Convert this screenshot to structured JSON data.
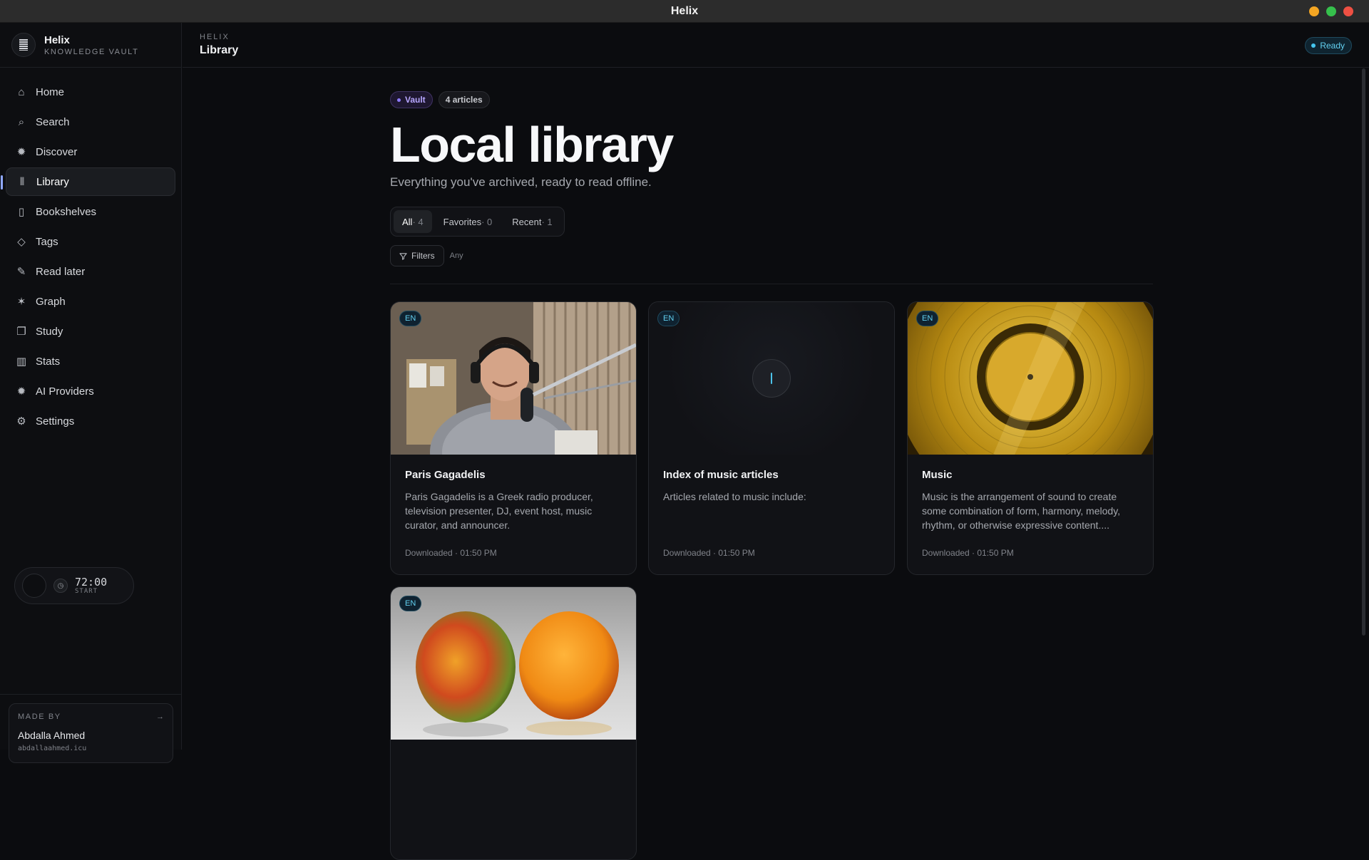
{
  "window": {
    "title": "Helix"
  },
  "brand": {
    "name": "Helix",
    "subtitle": "KNOWLEDGE VAULT"
  },
  "nav": [
    {
      "label": "Home",
      "icon": "home-icon",
      "glyph": "⌂",
      "active": false
    },
    {
      "label": "Search",
      "icon": "search-icon",
      "glyph": "⌕",
      "active": false
    },
    {
      "label": "Discover",
      "icon": "compass-icon",
      "glyph": "✹",
      "active": false
    },
    {
      "label": "Library",
      "icon": "library-icon",
      "glyph": "⫴",
      "active": true
    },
    {
      "label": "Bookshelves",
      "icon": "bookmark-icon",
      "glyph": "▯",
      "active": false
    },
    {
      "label": "Tags",
      "icon": "tag-icon",
      "glyph": "◇",
      "active": false
    },
    {
      "label": "Read later",
      "icon": "pin-icon",
      "glyph": "✎",
      "active": false
    },
    {
      "label": "Graph",
      "icon": "graph-icon",
      "glyph": "✶",
      "active": false
    },
    {
      "label": "Study",
      "icon": "cards-icon",
      "glyph": "❐",
      "active": false
    },
    {
      "label": "Stats",
      "icon": "bar-chart-icon",
      "glyph": "▥",
      "active": false
    },
    {
      "label": "AI Providers",
      "icon": "sparkle-icon",
      "glyph": "✹",
      "active": false
    },
    {
      "label": "Settings",
      "icon": "gear-icon",
      "glyph": "⚙",
      "active": false
    }
  ],
  "timer": {
    "time": "72:00",
    "label": "START"
  },
  "made_by": {
    "label": "MADE BY",
    "name": "Abdalla Ahmed",
    "url": "abdallaahmed.icu",
    "arrow": "→"
  },
  "header": {
    "crumb": "HELIX",
    "page": "Library",
    "status": "Ready"
  },
  "main": {
    "vault_pill": "Vault",
    "count_pill": "4 articles",
    "title": "Local library",
    "subtitle": "Everything you've archived, ready to read offline.",
    "tabs": [
      {
        "label": "All",
        "count": " · 4",
        "active": true
      },
      {
        "label": "Favorites",
        "count": " · 0",
        "active": false
      },
      {
        "label": "Recent",
        "count": " · 1",
        "active": false
      }
    ],
    "filters_label": "Filters",
    "filters_value": "Any"
  },
  "cards": [
    {
      "lang": "EN",
      "title": "Paris Gagadelis",
      "desc": "Paris Gagadelis is a Greek radio producer, television presenter, DJ, event host, music curator, and announcer.",
      "meta": "Downloaded · 01:50 PM",
      "image": "radio-host-photo"
    },
    {
      "lang": "EN",
      "title": "Index of music articles",
      "desc": "Articles related to music include:",
      "meta": "Downloaded · 01:50 PM",
      "image": "placeholder"
    },
    {
      "lang": "EN",
      "title": "Music",
      "desc": "Music is the arrangement of sound to create some combination of form, harmony, melody, rhythm, or otherwise expressive content....",
      "meta": "Downloaded · 01:50 PM",
      "image": "golden-record-photo"
    },
    {
      "lang": "EN",
      "title": "",
      "desc": "",
      "meta": "",
      "image": "mango-photo"
    }
  ],
  "colors": {
    "accent": "#8fa8ff",
    "status": "#45c6ef",
    "vault": "#8e7bff"
  }
}
